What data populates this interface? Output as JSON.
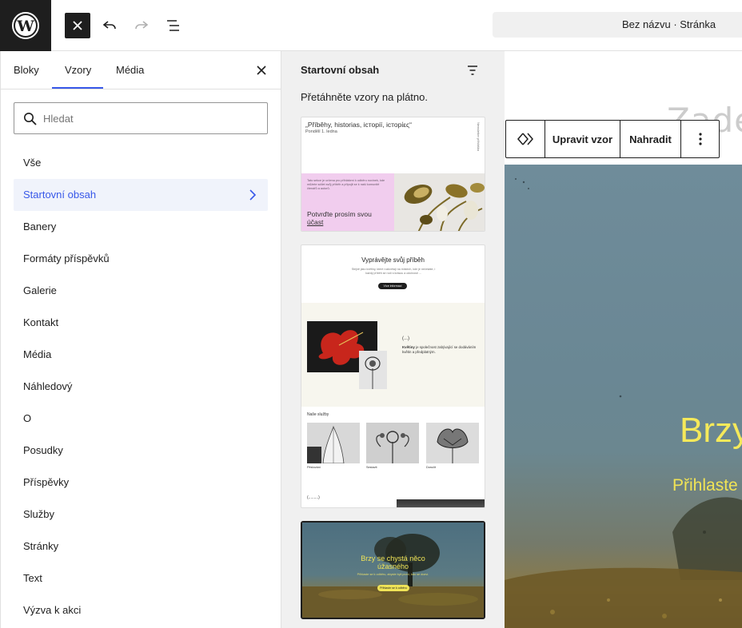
{
  "topbar": {
    "document_title": "Bez názvu · Stránka"
  },
  "inserter": {
    "tabs": [
      {
        "label": "Bloky"
      },
      {
        "label": "Vzory"
      },
      {
        "label": "Média"
      }
    ],
    "active_tab": "Vzory",
    "search": {
      "placeholder": "Hledat",
      "value": ""
    },
    "categories": [
      {
        "label": "Vše"
      },
      {
        "label": "Startovní obsah"
      },
      {
        "label": "Banery"
      },
      {
        "label": "Formáty příspěvků"
      },
      {
        "label": "Galerie"
      },
      {
        "label": "Kontakt"
      },
      {
        "label": "Média"
      },
      {
        "label": "Náhledový"
      },
      {
        "label": "O"
      },
      {
        "label": "Posudky"
      },
      {
        "label": "Příspěvky"
      },
      {
        "label": "Služby"
      },
      {
        "label": "Stránky"
      },
      {
        "label": "Text"
      },
      {
        "label": "Výzva k akci"
      }
    ],
    "active_category": "Startovní obsah"
  },
  "patterns": {
    "title": "Startovní obsah",
    "help": "Přetáhněte vzory na plátno.",
    "card1": {
      "heading": "„Příběhy, historias, історії, історίες“",
      "date": "Pondělí 1. ledna",
      "side": "Newsletter přihláška",
      "body": "Tato sekce je určena pro přihlášení k odběru novinek, kde můžete sdílet svůj příběh a připojit se k naší komunitě čtenářů a autorů.",
      "cta_line1": "Potvrďte prosím svou",
      "cta_line2": "účast"
    },
    "card2": {
      "heading": "Vyprávějte svůj příběh",
      "subtext": "Stejně jako květiny, které rozkvétají na místech, kde je nečekáte, i každý příběh se rodí s krásou a odolností ...",
      "button": "Více informací",
      "quote_mark": "(...)",
      "quote_bold": "Květiny",
      "quote": "je společnost zabývající se dodáváním květin a předplatným.",
      "services_title": "Naše služby",
      "services": [
        {
          "name": "Pěstování"
        },
        {
          "name": "Sestavit"
        },
        {
          "name": "Doručit"
        }
      ],
      "footer_mark": "(.........)"
    },
    "card3": {
      "title_line1": "Brzy se chystá něco",
      "title_line2": "úžasného",
      "subtext": "Přihlaste se k odběru, abyste byli první, kdo se dozví.",
      "button": "Přihlaste se k odběru"
    }
  },
  "canvas": {
    "heading_fragment": "Zade",
    "cover_title_fragment": "Brzy",
    "cover_sub_fragment": "Přihlaste",
    "toolbar": {
      "edit_label": "Upravit vzor",
      "replace_label": "Nahradit"
    }
  },
  "colors": {
    "accent": "#3858e9",
    "dark": "#1e1e1e",
    "cover_text": "#f5e95a",
    "card1_pink": "#f1cdee"
  }
}
